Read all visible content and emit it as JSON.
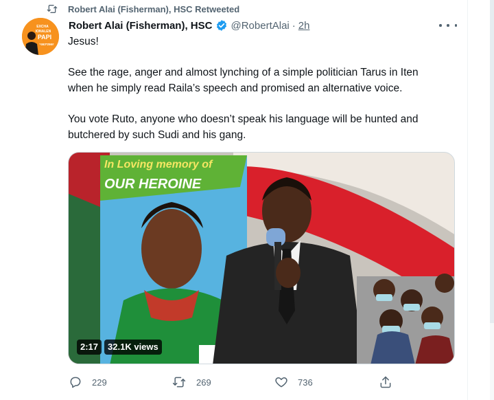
{
  "retweet": {
    "label": "Robert Alai (Fisherman), HSC Retweeted"
  },
  "tweet": {
    "author_name": "Robert Alai (Fisherman), HSC",
    "handle": "@RobertAlai",
    "separator": "·",
    "time": "2h",
    "verified": true,
    "text_lines": [
      "Jesus!",
      "See the rage, anger and almost lynching of a simple politician Tarus in Iten",
      "when he simply read Raila’s speech and promised an alternative voice.",
      "You vote Ruto, anyone who doesn’t speak his language will be hunted and",
      "butchered by such Sudi and his gang."
    ]
  },
  "avatar": {
    "text": "EXCHA IONALEN PAPI",
    "number": "*463*256#"
  },
  "media": {
    "banner_line1": "In Loving memory of",
    "banner_line2": "OUR HEROINE",
    "duration": "2:17",
    "views": "32.1K views"
  },
  "actions": {
    "replies": "229",
    "retweets": "269",
    "likes": "736"
  },
  "colors": {
    "text": "#0f1419",
    "secondary": "#536471",
    "verified": "#1d9bf0",
    "avatar_bg": "#f7921e"
  },
  "icons": [
    "retweet-icon",
    "verified-badge-icon",
    "more-icon",
    "reply-icon",
    "retweet-icon",
    "like-icon",
    "share-icon"
  ]
}
